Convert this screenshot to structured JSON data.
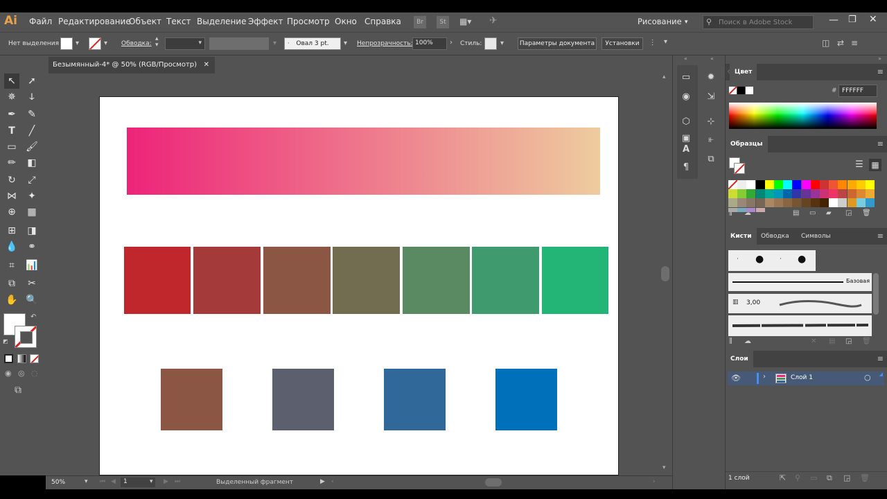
{
  "app": {
    "logo": "Ai"
  },
  "menu": {
    "items": [
      "Файл",
      "Редактирование",
      "Объект",
      "Текст",
      "Выделение",
      "Эффект",
      "Просмотр",
      "Окно",
      "Справка"
    ],
    "bridge": "Br",
    "stock": "St",
    "workspace": "Рисование",
    "search_placeholder": "Поиск в Adobe Stock"
  },
  "control": {
    "no_selection": "Нет выделения",
    "stroke_label": "Обводка:",
    "brush": "Овал 3 pt.",
    "opacity_label": "Непрозрачность:",
    "opacity_value": "100%",
    "style_label": "Стиль:",
    "doc_settings": "Параметры документа",
    "preferences": "Установки"
  },
  "document": {
    "tab_title": "Безымянный-4* @ 50% (RGB/Просмотр)",
    "gradient": {
      "from": "#ed2479",
      "to": "#eecc9f"
    },
    "swatches_row": [
      "#c0272d",
      "#a53a3a",
      "#8b5744",
      "#726c51",
      "#5a8a62",
      "#3f9a6d",
      "#23b575"
    ],
    "squares": [
      "#8b5644",
      "#5c5f6e",
      "#306899",
      "#0070bb"
    ]
  },
  "status": {
    "zoom": "50%",
    "page": "1",
    "info": "Выделенный фрагмент"
  },
  "panels": {
    "color": {
      "title": "Цвет",
      "hash": "#",
      "hex": "FFFFFF"
    },
    "swatches": {
      "title": "Образцы"
    },
    "brushes": {
      "tabs": [
        "Кисти",
        "Обводка",
        "Символы"
      ],
      "basic": "Базовая",
      "size": "3,00"
    },
    "layers": {
      "title": "Слои",
      "layer_name": "Слой 1",
      "count": "1 слой"
    }
  }
}
